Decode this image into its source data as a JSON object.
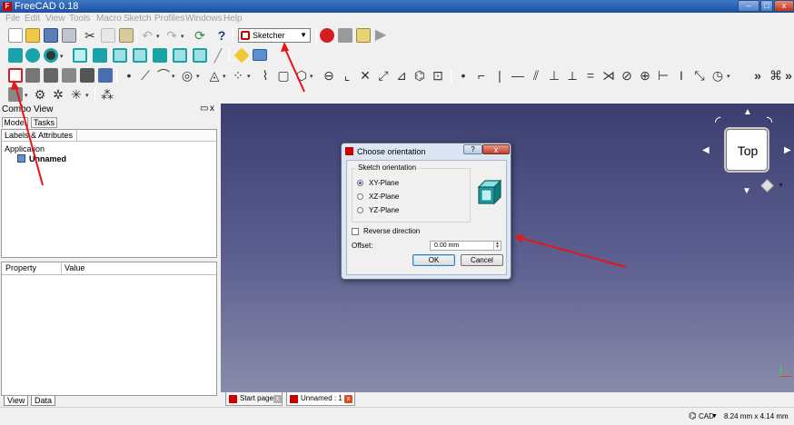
{
  "window": {
    "title": "FreeCAD 0.18",
    "minimize": "–",
    "maximize": "□",
    "close": "x"
  },
  "menu": [
    "File",
    "Edit",
    "View",
    "Tools",
    "Macro",
    "Sketch",
    "Profiles",
    "Windows",
    "Help"
  ],
  "workbench_selector": {
    "value": "Sketcher"
  },
  "combo_view": {
    "title": "Combo View",
    "float_icon": "▭",
    "close_icon": "x",
    "tabs": [
      "Model",
      "Tasks"
    ],
    "tree_header": "Labels & Attributes",
    "tree_root": "Application",
    "tree_doc": "Unnamed",
    "property_headers": [
      "Property",
      "Value"
    ],
    "bottom_tabs": [
      "View",
      "Data"
    ]
  },
  "nav_cube": {
    "face": "Top"
  },
  "dialog": {
    "title": "Choose orientation",
    "help": "?",
    "close": "x",
    "group_title": "Sketch orientation",
    "options": [
      {
        "label": "XY-Plane",
        "selected": true
      },
      {
        "label": "XZ-Plane",
        "selected": false
      },
      {
        "label": "YZ-Plane",
        "selected": false
      }
    ],
    "reverse_label": "Reverse direction",
    "offset_label": "Offset:",
    "offset_value": "0.00 mm",
    "ok": "OK",
    "cancel": "Cancel"
  },
  "doc_tabs": [
    {
      "label": "Start page",
      "active": false
    },
    {
      "label": "Unnamed : 1",
      "active": true
    }
  ],
  "status": {
    "nav_style": "CAD",
    "dimensions": "8.24 mm x 4.14 mm"
  },
  "colors": {
    "annotation_arrow": "#e8141a",
    "view_top": "#3b3e6f",
    "view_bottom": "#8a8cab",
    "toolbar_icon_teal": "#1aa3a8"
  },
  "icons": {
    "toolbar_row1": [
      "new-file-icon",
      "open-file-icon",
      "save-icon",
      "print-icon",
      "cut-icon",
      "copy-icon",
      "paste-icon",
      "undo-icon",
      "redo-icon",
      "refresh-icon",
      "whats-this-icon",
      "macro-record-icon",
      "macro-stop-icon",
      "macro-edit-icon",
      "macro-play-icon"
    ],
    "toolbar_row2": [
      "fit-all-icon",
      "fit-selection-icon",
      "draw-style-icon",
      "isometric-view-icon",
      "front-view-icon",
      "top-view-icon",
      "right-view-icon",
      "rear-view-icon",
      "bottom-view-icon",
      "left-view-icon",
      "measure-icon",
      "part-icon",
      "group-icon"
    ],
    "toolbar_row3": [
      "new-sketch-icon",
      "edit-sketch-icon",
      "leave-sketch-icon",
      "view-sketch-icon",
      "map-sketch-icon",
      "reorient-sketch-icon"
    ]
  }
}
